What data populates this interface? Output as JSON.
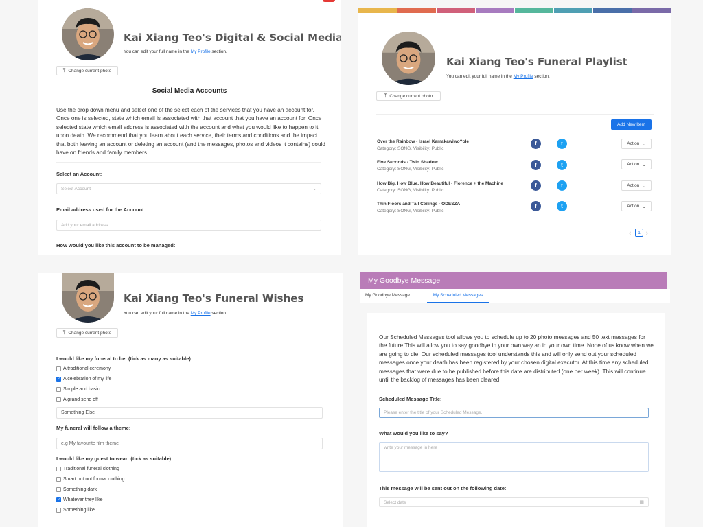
{
  "profile": {
    "edit_note_prefix": "You can edit your full name in the",
    "edit_note_link": "My Profile",
    "edit_note_suffix": "section.",
    "change_photo": "Change current photo"
  },
  "will": {
    "title": "Kai Xiang Teo's Digital & Social Media Will",
    "section_heading": "Social Media Accounts",
    "intro": "Use the drop down menu and select one of the select each of the services that you have an account for. Once one is selected, state which email is associated with that account that you have an account for. Once selected state which email address is associated with the account and what you would like to happen to it upon death. We recommend that you learn about each service, their terms and conditions and the impact that both leaving an account or deleting an account (and the messages, photos and videos it contains) could have on friends and family members.",
    "select_label": "Select an Account:",
    "select_placeholder": "Select Account",
    "email_label": "Email address used for the Account:",
    "email_placeholder": "Add your email address",
    "manage_label": "How would you like this account to be managed:"
  },
  "playlist": {
    "title": "Kai Xiang Teo's Funeral Playlist",
    "add_button": "Add New Item",
    "action_label": "Action",
    "items": [
      {
        "title": "Over the Rainbow - Israel Kamakawiwo?ole",
        "meta": "Category: SONG, Visibility: Public"
      },
      {
        "title": "Five Seconds - Twin Shadow",
        "meta": "Category: SONG, Visibility: Public"
      },
      {
        "title": "How Big, How Blue, How Beautiful - Florence + the Machine",
        "meta": "Category: SONG, Visibility: Public"
      },
      {
        "title": "Thin Floors and Tall Ceilings - ODESZA",
        "meta": "Category: SONG, Visibility: Public"
      }
    ],
    "page": "1",
    "rainbow": [
      "#e8b64c",
      "#e06b4f",
      "#d0607a",
      "#a77bbf",
      "#56b79c",
      "#4f9fb3",
      "#4a6fa9",
      "#7a6aa8"
    ]
  },
  "wishes": {
    "title": "Kai Xiang Teo's Funeral Wishes",
    "funeral_label": "I would like my funeral to be: (tick as many as suitable)",
    "funeral_options": [
      {
        "label": "A traditional ceremony",
        "checked": false
      },
      {
        "label": "A celebration of my life",
        "checked": true
      },
      {
        "label": "Simple and basic",
        "checked": false
      },
      {
        "label": "A grand send off",
        "checked": false
      }
    ],
    "other_value": "Something Else",
    "theme_label": "My funeral will follow a theme:",
    "theme_placeholder": "e.g My favourite film theme",
    "wear_label": "I would like my guest to wear: (tick as suitable)",
    "wear_options": [
      {
        "label": "Traditional funeral clothing",
        "checked": false
      },
      {
        "label": "Smart but not formal clothing",
        "checked": false
      },
      {
        "label": "Something dark",
        "checked": false
      },
      {
        "label": "Whatever they like",
        "checked": true
      },
      {
        "label": "Something like",
        "checked": false
      }
    ]
  },
  "goodbye": {
    "header": "My Goodbye Message",
    "header_color": "#b97cb8",
    "tabs": [
      "My Goodbye Message",
      "My Scheduled Messages"
    ],
    "intro": "Our Scheduled Messages tool allows you to schedule up to 20 photo messages and 50 text messages for the future.This will allow you to say goodbye in your own way an in your own time. None of us know when we are going to die. Our scheduled messages tool understands this and will only send out your scheduled messages once your death has been registered by your chosen digital executor. At this time any scheduled messages that were due to be published before this date are distributed (one per week). This will continue until the backlog of messages has been cleared.",
    "title_label": "Scheduled Message Title:",
    "title_placeholder": "Please enter the title of your Scheduled Message.",
    "say_label": "What would you like to say?",
    "say_placeholder": "write your message in here",
    "date_label": "This message will be sent out on the following date:",
    "date_placeholder": "Select date"
  }
}
